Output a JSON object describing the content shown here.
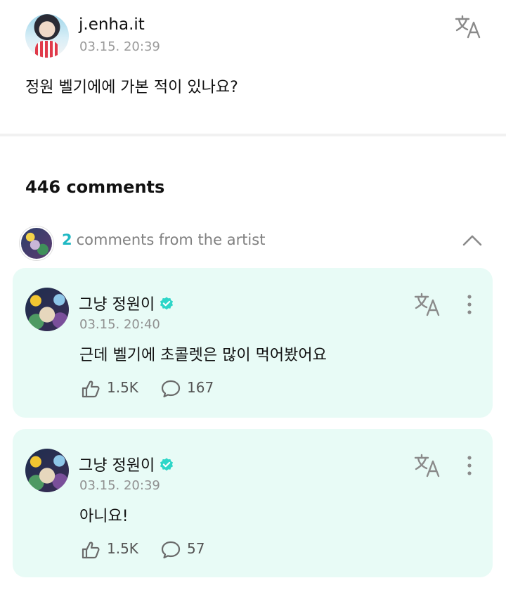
{
  "post": {
    "author": "j.enha.it",
    "time": "03.15. 20:39",
    "body": "정원 벨기에에 가본 적이 있나요?",
    "translate_icon": "translate-icon"
  },
  "comments": {
    "count_label": "446 comments",
    "artist_section": {
      "count": "2",
      "label": "comments from the artist",
      "chevron_icon": "chevron-up-icon"
    },
    "items": [
      {
        "author": "그냥 정원이",
        "verified": true,
        "time": "03.15. 20:40",
        "text": "근데 벨기에 초콜렛은 많이 먹어봤어요",
        "likes": "1.5K",
        "replies": "167"
      },
      {
        "author": "그냥 정원이",
        "verified": true,
        "time": "03.15. 20:39",
        "text": "아니요!",
        "likes": "1.5K",
        "replies": "57"
      }
    ]
  },
  "colors": {
    "accent": "#1fb8c3",
    "card_background": "#e8fbf6",
    "verified_badge": "#2ed6c8",
    "muted_text": "#909090"
  }
}
